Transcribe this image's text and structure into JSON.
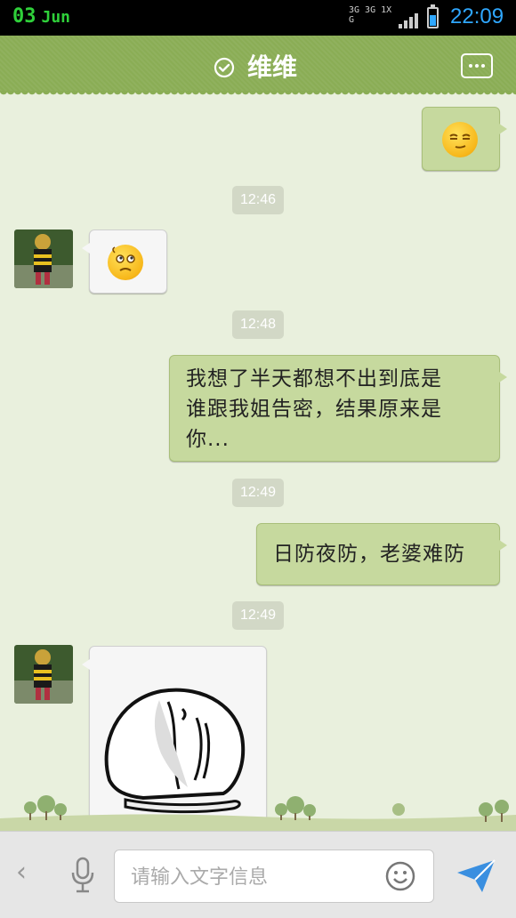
{
  "status_bar": {
    "date_day": "03",
    "date_month": "Jun",
    "network_top": "3G 3G 1X G",
    "time": "22:09"
  },
  "header": {
    "title": "维维",
    "menu_icon": "more-dots-icon"
  },
  "messages": [
    {
      "type": "emoji",
      "sender": "me",
      "emoji": "smirk-emoji"
    },
    {
      "type": "time",
      "text": "12:46"
    },
    {
      "type": "emoji",
      "sender": "them",
      "emoji": "confused-emoji"
    },
    {
      "type": "time",
      "text": "12:48"
    },
    {
      "type": "text",
      "sender": "me",
      "lines": [
        "我想了半天都想不出到底是",
        "谁跟我姐告密，结果原来是",
        "你..."
      ]
    },
    {
      "type": "time",
      "text": "12:49"
    },
    {
      "type": "text",
      "sender": "me",
      "lines": [
        "日防夜防，老婆难防"
      ]
    },
    {
      "type": "time",
      "text": "12:49"
    },
    {
      "type": "sticker",
      "sender": "them",
      "sticker": "crying-cartoon-sticker"
    }
  ],
  "input_bar": {
    "placeholder": "请输入文字信息",
    "back_icon": "chevron-left-icon",
    "mic_icon": "microphone-icon",
    "emoji_icon": "smiley-icon",
    "send_icon": "send-icon"
  },
  "colors": {
    "header_green": "#8aad55",
    "my_bubble": "#c6d99e",
    "background": "#e9f0dd",
    "time_accent": "#2fa7ff"
  }
}
